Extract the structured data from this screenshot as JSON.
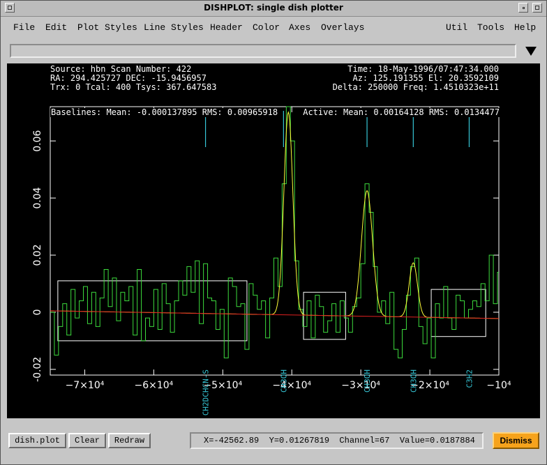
{
  "window": {
    "title": "DISHPLOT: single dish plotter"
  },
  "menu": [
    "File",
    "Edit",
    "Plot Styles",
    "Line Styles",
    "Header",
    "Color",
    "Axes",
    "Overlays",
    "Util",
    "Tools",
    "Help"
  ],
  "header": {
    "line1_left": "Source: hbn Scan Number: 422",
    "line2_left": "RA: 294.425727 DEC: -15.9456957",
    "line3_left": "Trx: 0 Tcal: 400 Tsys: 367.647583",
    "line1_right": "Time: 18-May-1996/07:47:34.000",
    "line2_right": "Az: 125.191355 El: 20.3592109",
    "line3_right": "Delta: 250000 Freq: 1.4510323e+11",
    "baselines": "Baselines: Mean: -0.000137895 RMS: 0.00965918",
    "active": "Active: Mean: 0.00164128 RMS: 0.0134477"
  },
  "buttons": {
    "dish_plot": "dish.plot",
    "clear": "Clear",
    "redraw": "Redraw",
    "dismiss": "Dismiss"
  },
  "status": "X=-42562.89  Y=0.01267819  Channel=67  Value=0.0187884",
  "colors": {
    "spectrum": "#3ddc3d",
    "fit": "#ffff3a",
    "baseline": "#e02020",
    "marker": "#36c6d6",
    "axes": "#ffffff",
    "background": "#000000",
    "dismiss": "#f6a31c"
  },
  "chart_data": {
    "type": "line",
    "xlim": [
      -75000,
      -10000
    ],
    "ylim": [
      -0.022,
      0.072
    ],
    "xticks": [
      -70000,
      -60000,
      -50000,
      -40000,
      -30000,
      -20000,
      -10000
    ],
    "xtick_labels": [
      "−7×10⁴",
      "−6×10⁴",
      "−5×10⁴",
      "−4×10⁴",
      "−3×10⁴",
      "−2×10⁴",
      "−10⁴"
    ],
    "yticks": [
      -0.02,
      0,
      0.02,
      0.04,
      0.06
    ],
    "ytick_labels": [
      "-0.02",
      "0",
      "0.02",
      "0.04",
      "0.06"
    ],
    "line_labels": [
      {
        "x": -52500,
        "text": "CH2DCHCN-S"
      },
      {
        "x": -41200,
        "text": "CH3OH"
      },
      {
        "x": -29100,
        "text": "CH3OH"
      },
      {
        "x": -22400,
        "text": "CH3OH"
      },
      {
        "x": -14300,
        "text": "C3H2"
      }
    ],
    "baseline_boxes": [
      {
        "x0": -73900,
        "x1": -46500,
        "y0": -0.01,
        "y1": 0.011
      },
      {
        "x0": -38300,
        "x1": -32200,
        "y0": -0.0095,
        "y1": 0.007
      },
      {
        "x0": -19800,
        "x1": -11900,
        "y0": -0.0085,
        "y1": 0.008
      }
    ],
    "gaussians": [
      {
        "center": -40500,
        "amp": 0.071,
        "sigma": 650
      },
      {
        "center": -29100,
        "amp": 0.044,
        "sigma": 800
      },
      {
        "center": -22400,
        "amp": 0.019,
        "sigma": 600
      }
    ],
    "baseline_line": [
      [
        -75000,
        0.0005
      ],
      [
        -10000,
        -0.0022
      ]
    ],
    "spectrum": [
      [
        -75000,
        0.0
      ],
      [
        -74400,
        -0.015
      ],
      [
        -73800,
        -0.005
      ],
      [
        -73200,
        0.003
      ],
      [
        -72600,
        -0.008
      ],
      [
        -72000,
        0.008
      ],
      [
        -71400,
        -0.002
      ],
      [
        -70800,
        0.004
      ],
      [
        -70200,
        0.009
      ],
      [
        -69600,
        -0.004
      ],
      [
        -69000,
        0.007
      ],
      [
        -68400,
        -0.005
      ],
      [
        -67800,
        0.005
      ],
      [
        -67200,
        0.015
      ],
      [
        -66600,
        0.002
      ],
      [
        -66000,
        0.012
      ],
      [
        -65400,
        -0.003
      ],
      [
        -64800,
        0.007
      ],
      [
        -64200,
        0.004
      ],
      [
        -63600,
        0.009
      ],
      [
        -63000,
        -0.008
      ],
      [
        -62400,
        0.015
      ],
      [
        -61800,
        -0.01
      ],
      [
        -61200,
        -0.002
      ],
      [
        -60600,
        -0.005
      ],
      [
        -60000,
        0.008
      ],
      [
        -59400,
        -0.006
      ],
      [
        -58800,
        0.01
      ],
      [
        -58200,
        0.003
      ],
      [
        -57600,
        -0.007
      ],
      [
        -57000,
        0.004
      ],
      [
        -56400,
        0.011
      ],
      [
        -55800,
        0.006
      ],
      [
        -55200,
        0.016
      ],
      [
        -54600,
        0.007
      ],
      [
        -54000,
        0.018
      ],
      [
        -53400,
        -0.004
      ],
      [
        -52800,
        0.017
      ],
      [
        -52200,
        0.005
      ],
      [
        -51600,
        0.004
      ],
      [
        -51000,
        -0.006
      ],
      [
        -50400,
        0.001
      ],
      [
        -49800,
        -0.016
      ],
      [
        -49200,
        0.012
      ],
      [
        -48600,
        0.009
      ],
      [
        -48000,
        0.002
      ],
      [
        -47400,
        0.003
      ],
      [
        -46800,
        -0.013
      ],
      [
        -46200,
        0.01
      ],
      [
        -45600,
        0.006
      ],
      [
        -45000,
        0.001
      ],
      [
        -44400,
        0.004
      ],
      [
        -43800,
        -0.009
      ],
      [
        -43200,
        0.005
      ],
      [
        -42600,
        0.019
      ],
      [
        -42000,
        0.009
      ],
      [
        -41400,
        0.045
      ],
      [
        -40800,
        0.074
      ],
      [
        -40200,
        0.06
      ],
      [
        -39600,
        0.018
      ],
      [
        -39000,
        0.001
      ],
      [
        -38400,
        -0.005
      ],
      [
        -37800,
        0.004
      ],
      [
        -37200,
        -0.009
      ],
      [
        -36600,
        0.006
      ],
      [
        -36000,
        0.002
      ],
      [
        -35400,
        -0.007
      ],
      [
        -34800,
        -0.003
      ],
      [
        -34200,
        0.003
      ],
      [
        -33600,
        -0.007
      ],
      [
        -33000,
        0.004
      ],
      [
        -32400,
        -0.002
      ],
      [
        -31800,
        -0.007
      ],
      [
        -31200,
        0.002
      ],
      [
        -30600,
        0.005
      ],
      [
        -30000,
        0.017
      ],
      [
        -29400,
        0.045
      ],
      [
        -28800,
        0.035
      ],
      [
        -28200,
        0.016
      ],
      [
        -27600,
        0.0
      ],
      [
        -27000,
        0.004
      ],
      [
        -26400,
        -0.004
      ],
      [
        -25800,
        0.007
      ],
      [
        -25200,
        -0.013
      ],
      [
        -24600,
        -0.016
      ],
      [
        -24000,
        -0.006
      ],
      [
        -23400,
        0.006
      ],
      [
        -22800,
        0.016
      ],
      [
        -22200,
        0.019
      ],
      [
        -21600,
        -0.005
      ],
      [
        -21000,
        -0.011
      ],
      [
        -20400,
        -0.002
      ],
      [
        -19800,
        -0.016
      ],
      [
        -19200,
        0.003
      ],
      [
        -18600,
        -0.002
      ],
      [
        -18000,
        0.009
      ],
      [
        -17400,
        -0.002
      ],
      [
        -16800,
        -0.006
      ],
      [
        -16200,
        0.006
      ],
      [
        -15600,
        0.004
      ],
      [
        -15000,
        -0.002
      ],
      [
        -14400,
        0.001
      ],
      [
        -13800,
        0.004
      ],
      [
        -13200,
        0.002
      ],
      [
        -12600,
        0.01
      ],
      [
        -12000,
        0.004
      ],
      [
        -11400,
        0.02
      ],
      [
        -10800,
        0.003
      ],
      [
        -10200,
        0.014
      ]
    ]
  }
}
